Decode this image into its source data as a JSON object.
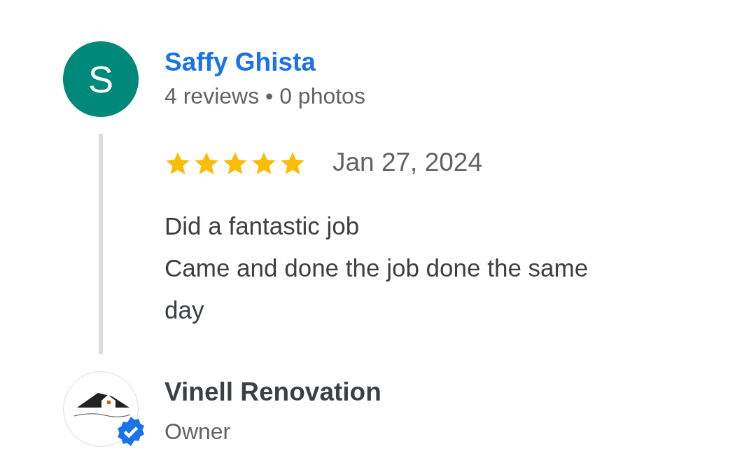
{
  "review": {
    "author": {
      "initial": "S",
      "name": "Saffy Ghista",
      "stats": "4 reviews • 0 photos"
    },
    "stars": 5,
    "date": "Jan 27, 2024",
    "text": "Did a fantastic job\nCame and done the job done the same day"
  },
  "owner_reply": {
    "name": "Vinell Renovation",
    "role": "Owner",
    "verified": true
  }
}
